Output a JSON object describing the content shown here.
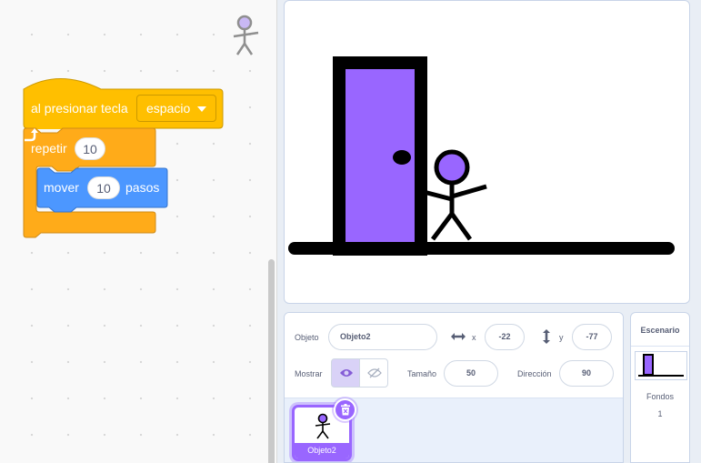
{
  "code": {
    "hat_block": {
      "label": "al presionar tecla",
      "key": "espacio"
    },
    "repeat_block": {
      "label": "repetir",
      "count": "10"
    },
    "move_block": {
      "label": "mover",
      "steps": "10",
      "unit": "pasos"
    }
  },
  "sprite_info": {
    "sprite_label": "Objeto",
    "sprite_name": "Objeto2",
    "x_label": "x",
    "x_value": "-22",
    "y_label": "y",
    "y_value": "-77",
    "show_label": "Mostrar",
    "size_label": "Tamaño",
    "size_value": "50",
    "direction_label": "Dirección",
    "direction_value": "90"
  },
  "sprite_list": [
    {
      "name": "Objeto2",
      "selected": true
    }
  ],
  "stage_selector": {
    "title": "Escenario",
    "backdrops_label": "Fondos",
    "backdrops_count": "1"
  },
  "colors": {
    "events": "#ffbf00",
    "control": "#ffab19",
    "motion": "#4c97ff",
    "selection": "#9966ff",
    "door": "#9966ff"
  },
  "icons": [
    "sprite-stick-figure-icon",
    "loop-arrow-icon",
    "dropdown-caret-icon",
    "horizontal-arrows-icon",
    "vertical-arrows-icon",
    "eye-icon",
    "eye-slash-icon",
    "trash-icon"
  ]
}
